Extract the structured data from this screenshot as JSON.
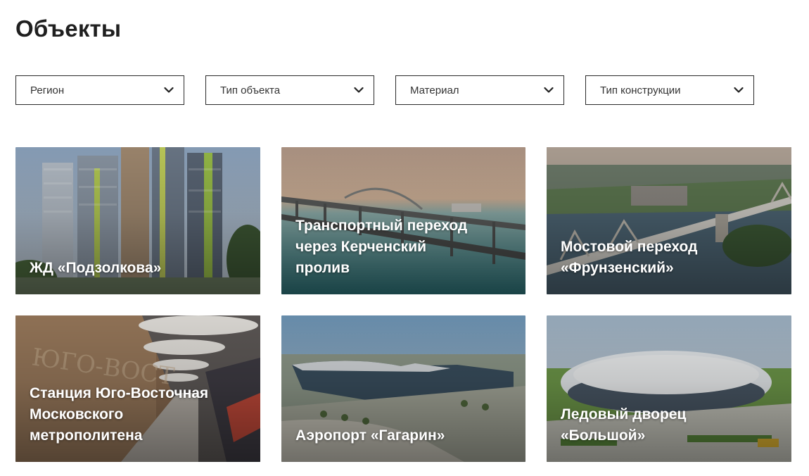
{
  "page": {
    "title": "Объекты"
  },
  "filters": [
    {
      "label": "Регион",
      "icon": "chevron-down-icon"
    },
    {
      "label": "Тип объекта",
      "icon": "chevron-down-icon"
    },
    {
      "label": "Материал",
      "icon": "chevron-down-icon"
    },
    {
      "label": "Тип конструкции",
      "icon": "chevron-down-icon"
    }
  ],
  "cards": [
    {
      "title": "ЖД «Подзолкова»"
    },
    {
      "title": "Транспортный переход\nчерез Керченский\nпролив"
    },
    {
      "title": "Мостовой переход\n«Фрунзенский»"
    },
    {
      "title": "Станция Юго-Восточная\nМосковского\nметрополитена"
    },
    {
      "title": "Аэропорт «Гагарин»"
    },
    {
      "title": "Ледовый дворец\n«Большой»"
    }
  ],
  "colors": {
    "text": "#1f1f1f",
    "border": "#2a2a2a",
    "caption": "#ffffff"
  }
}
